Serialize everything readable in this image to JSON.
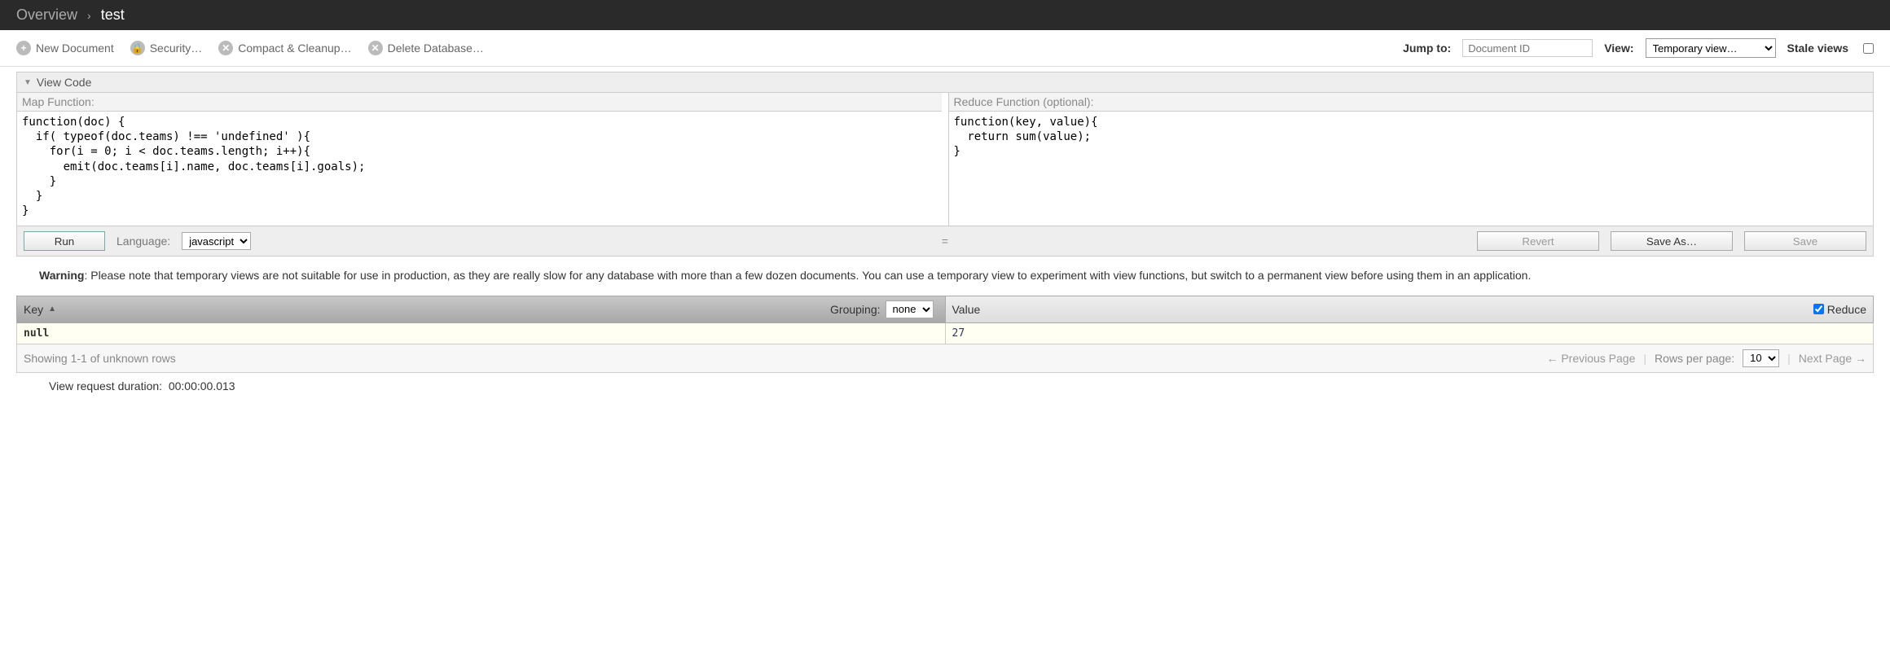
{
  "breadcrumb": {
    "overview": "Overview",
    "db": "test"
  },
  "toolbar": {
    "new_doc": "New Document",
    "security": "Security…",
    "compact": "Compact & Cleanup…",
    "delete_db": "Delete Database…",
    "jump_label": "Jump to:",
    "jump_placeholder": "Document ID",
    "view_label": "View:",
    "view_selected": "Temporary view…",
    "stale_label": "Stale views"
  },
  "viewcode": {
    "header": "View Code",
    "map_label": "Map Function:",
    "map_code": "function(doc) {\n  if( typeof(doc.teams) !== 'undefined' ){\n    for(i = 0; i < doc.teams.length; i++){\n      emit(doc.teams[i].name, doc.teams[i].goals);\n    }\n  }\n}",
    "reduce_label": "Reduce Function (optional):",
    "reduce_code": "function(key, value){\n  return sum(value);\n}",
    "run": "Run",
    "language_label": "Language:",
    "language_selected": "javascript",
    "revert": "Revert",
    "save_as": "Save As…",
    "save": "Save"
  },
  "warning": {
    "prefix": "Warning",
    "text": ": Please note that temporary views are not suitable for use in production, as they are really slow for any database with more than a few dozen documents. You can use a temporary view to experiment with view functions, but switch to a permanent view before using them in an application."
  },
  "results": {
    "key_header": "Key",
    "grouping_label": "Grouping:",
    "grouping_selected": "none",
    "value_header": "Value",
    "reduce_label": "Reduce",
    "rows": [
      {
        "key": "null",
        "value": "27"
      }
    ],
    "showing": "Showing 1-1 of unknown rows",
    "prev": "← Previous Page",
    "rpp_label": "Rows per page:",
    "rpp_selected": "10",
    "next": "Next Page →"
  },
  "duration": {
    "label": "View request duration:",
    "value": "00:00:00.013"
  }
}
